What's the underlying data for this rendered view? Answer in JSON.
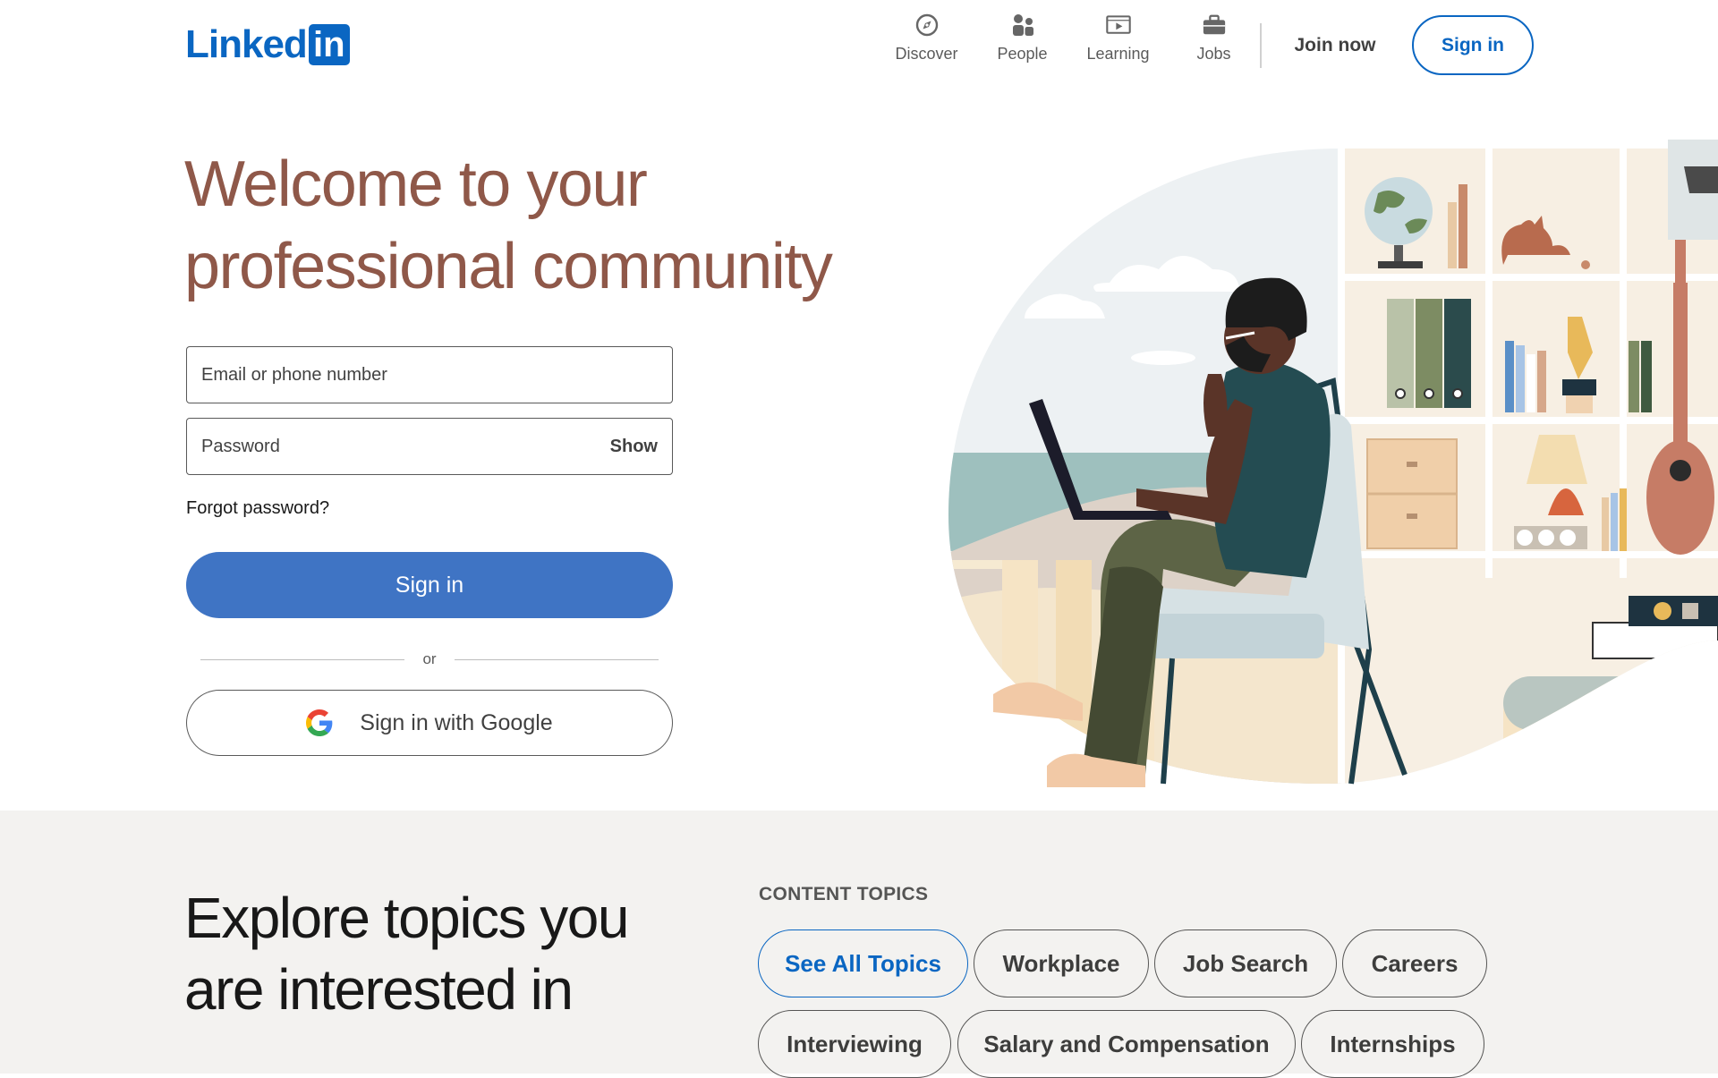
{
  "header": {
    "logo_word": "Linked",
    "logo_box": "in",
    "nav": [
      {
        "label": "Discover",
        "icon": "compass-icon"
      },
      {
        "label": "People",
        "icon": "people-icon"
      },
      {
        "label": "Learning",
        "icon": "play-screen-icon"
      },
      {
        "label": "Jobs",
        "icon": "briefcase-icon"
      }
    ],
    "join_now": "Join now",
    "sign_in": "Sign in"
  },
  "hero": {
    "title_line1": "Welcome to your",
    "title_line2": "professional community"
  },
  "form": {
    "email_placeholder": "Email or phone number",
    "password_placeholder": "Password",
    "show_label": "Show",
    "forgot_password": "Forgot password?",
    "sign_in": "Sign in",
    "or": "or",
    "google_sign_in": "Sign in with Google"
  },
  "explore": {
    "title_line1": "Explore topics you",
    "title_line2": "are interested in",
    "topics_heading": "CONTENT TOPICS",
    "topics": [
      "See All Topics",
      "Workplace",
      "Job Search",
      "Careers",
      "Interviewing",
      "Salary and Compensation",
      "Internships"
    ]
  },
  "colors": {
    "brand": "#0a66c2",
    "primary_button": "#3f74c4",
    "headline": "#8f5849",
    "section_bg": "#f3f2f0"
  }
}
